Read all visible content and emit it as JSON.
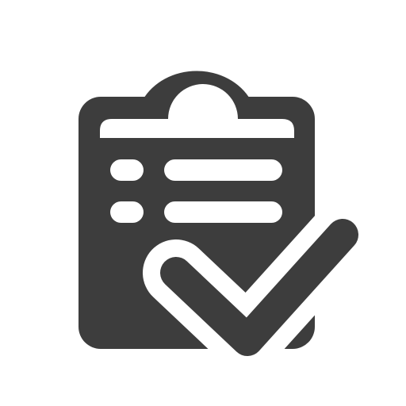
{
  "icon": {
    "name": "clipboard-check-icon",
    "colors": {
      "foreground": "#3d3d3d",
      "background": "#ffffff"
    }
  }
}
